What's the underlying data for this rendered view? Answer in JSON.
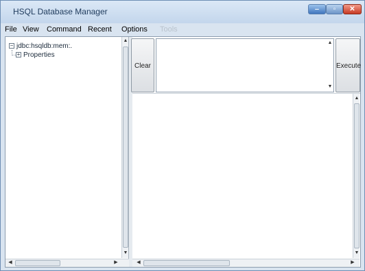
{
  "window": {
    "title": "HSQL Database Manager",
    "controls": {
      "minimize": "‒",
      "maximize": "▫",
      "close": "✕"
    }
  },
  "menu": [
    {
      "label": "File",
      "enabled": true
    },
    {
      "label": "View",
      "enabled": true
    },
    {
      "label": "Command",
      "enabled": true
    },
    {
      "label": "Recent",
      "enabled": true
    },
    {
      "label": "Options",
      "enabled": true
    },
    {
      "label": "Tools",
      "enabled": false
    }
  ],
  "tree": {
    "root": {
      "label": "jdbc:hsqldb:mem:.",
      "toggle": "−"
    },
    "child": {
      "label": "Properties",
      "toggle": "+"
    }
  },
  "buttons": {
    "clear": "Clear",
    "execute": "Execute"
  },
  "sql_input": {
    "value": ""
  },
  "scroll": {
    "up": "▲",
    "down": "▼",
    "left": "◀",
    "right": "▶"
  },
  "colors": {
    "accent": "#3f75bd",
    "close": "#c73a24"
  }
}
